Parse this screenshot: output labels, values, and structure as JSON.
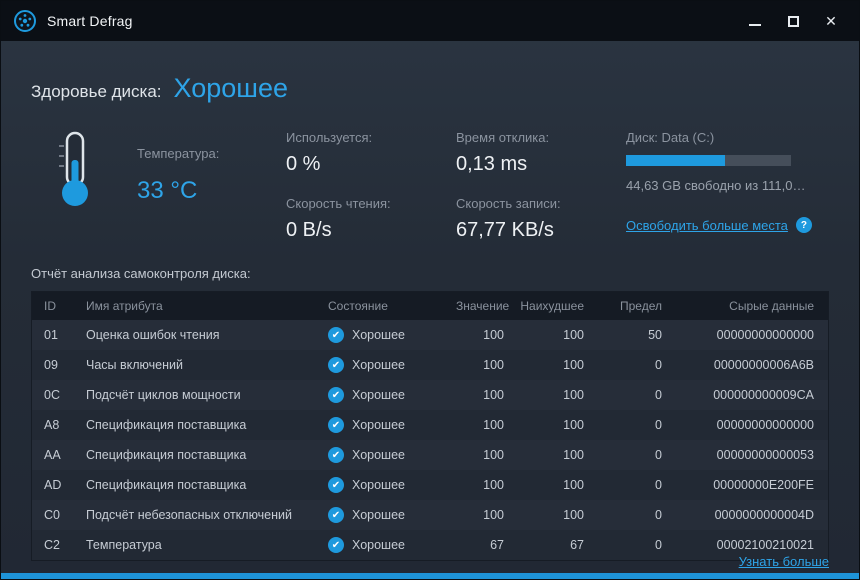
{
  "window": {
    "title": "Smart Defrag",
    "close_glyph": "✕"
  },
  "accent_color": "#1e9ade",
  "health": {
    "label": "Здоровье диска:",
    "value": "Хорошее"
  },
  "temperature": {
    "label": "Температура:",
    "value": "33 °C"
  },
  "stats": [
    {
      "label": "Используется:",
      "value": "0 %"
    },
    {
      "label": "Время отклика:",
      "value": "0,13 ms"
    },
    {
      "label": "Скорость чтения:",
      "value": "0 B/s"
    },
    {
      "label": "Скорость записи:",
      "value": "67,77 KB/s"
    }
  ],
  "disk": {
    "label": "Диск: Data (C:)",
    "usage_percent": 60,
    "free_text": "44,63 GB свободно из 111,0…",
    "free_space_link": "Освободить больше места",
    "help_badge": "?"
  },
  "smart": {
    "title": "Отчёт анализа самоконтроля диска:",
    "columns": [
      "ID",
      "Имя атрибута",
      "Состояние",
      "Значение",
      "Наихудшее",
      "Предел",
      "Сырые данные"
    ],
    "check_glyph": "✔",
    "rows": [
      {
        "id": "01",
        "name": "Оценка ошибок чтения",
        "status": "Хорошее",
        "value": "100",
        "worst": "100",
        "threshold": "50",
        "raw": "00000000000000"
      },
      {
        "id": "09",
        "name": "Часы включений",
        "status": "Хорошее",
        "value": "100",
        "worst": "100",
        "threshold": "0",
        "raw": "00000000006A6B"
      },
      {
        "id": "0C",
        "name": "Подсчёт циклов мощности",
        "status": "Хорошее",
        "value": "100",
        "worst": "100",
        "threshold": "0",
        "raw": "000000000009CA"
      },
      {
        "id": "A8",
        "name": "Спецификация поставщика",
        "status": "Хорошее",
        "value": "100",
        "worst": "100",
        "threshold": "0",
        "raw": "00000000000000"
      },
      {
        "id": "AA",
        "name": "Спецификация поставщика",
        "status": "Хорошее",
        "value": "100",
        "worst": "100",
        "threshold": "0",
        "raw": "00000000000053"
      },
      {
        "id": "AD",
        "name": "Спецификация поставщика",
        "status": "Хорошее",
        "value": "100",
        "worst": "100",
        "threshold": "0",
        "raw": "00000000E200FE"
      },
      {
        "id": "C0",
        "name": "Подсчёт небезопасных отключений",
        "status": "Хорошее",
        "value": "100",
        "worst": "100",
        "threshold": "0",
        "raw": "0000000000004D"
      },
      {
        "id": "C2",
        "name": "Температура",
        "status": "Хорошее",
        "value": "67",
        "worst": "67",
        "threshold": "0",
        "raw": "00002100210021"
      }
    ]
  },
  "footer": {
    "learn_more": "Узнать больше"
  }
}
